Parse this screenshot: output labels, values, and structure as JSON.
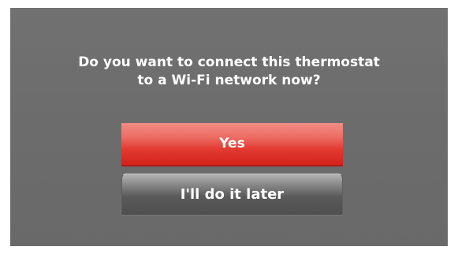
{
  "dialog": {
    "prompt_line1": "Do you want to connect this thermostat",
    "prompt_line2": "to a Wi-Fi network now?",
    "yes_label": "Yes",
    "later_label": "I'll do it later"
  },
  "colors": {
    "background": "#6e6e6e",
    "yes_button": "#e23a31",
    "later_button": "#5a5a5a",
    "text": "#ffffff"
  }
}
